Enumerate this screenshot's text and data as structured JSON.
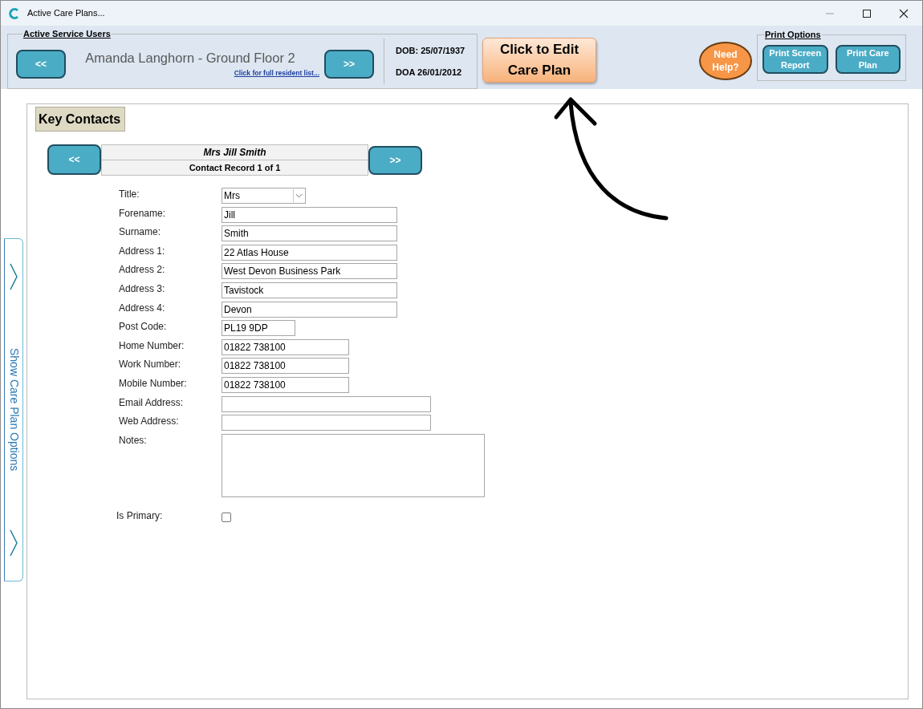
{
  "window": {
    "title": "Active Care Plans..."
  },
  "service_users": {
    "heading": "Active Service Users",
    "prev": "<<",
    "next": ">>",
    "resident": "Amanda Langhorn - Ground Floor 2",
    "list_link": "Click for full resident list...",
    "dob": "DOB: 25/07/1937",
    "doa": "DOA 26/01/2012"
  },
  "edit_button": "Click to Edit Care Plan",
  "help_button": "Need Help?",
  "print_options": {
    "heading": "Print Options",
    "buttons": [
      "Print Screen Report",
      "Print Care Plan"
    ]
  },
  "side_tab": {
    "label": "Show Care Plan Options"
  },
  "section_title": "Key Contacts",
  "contact_nav": {
    "prev": "<<",
    "next": ">>",
    "name": "Mrs Jill Smith",
    "record": "Contact Record 1 of 1"
  },
  "fields": [
    {
      "label": "Title:",
      "kind": "select",
      "value": "Mrs"
    },
    {
      "label": "Forename:",
      "kind": "text",
      "value": "Jill"
    },
    {
      "label": "Surname:",
      "kind": "text",
      "value": "Smith"
    },
    {
      "label": "Address 1:",
      "kind": "text",
      "value": "22 Atlas House"
    },
    {
      "label": "Address 2:",
      "kind": "text",
      "value": "West Devon Business Park"
    },
    {
      "label": "Address 3:",
      "kind": "text",
      "value": "Tavistock"
    },
    {
      "label": "Address 4:",
      "kind": "text",
      "value": "Devon"
    },
    {
      "label": "Post Code:",
      "kind": "short",
      "value": "PL19 9DP"
    },
    {
      "label": "Home Number:",
      "kind": "phone",
      "value": "01822 738100"
    },
    {
      "label": "Work Number:",
      "kind": "phone",
      "value": "01822 738100"
    },
    {
      "label": "Mobile Number:",
      "kind": "phone",
      "value": "01822 738100"
    },
    {
      "label": "Email Address:",
      "kind": "wide"
    },
    {
      "label": "Web Address:",
      "kind": "wide"
    },
    {
      "label": "Notes:",
      "kind": "notes"
    },
    {
      "label": "Is Primary:",
      "kind": "checkbox",
      "checked": false
    }
  ]
}
